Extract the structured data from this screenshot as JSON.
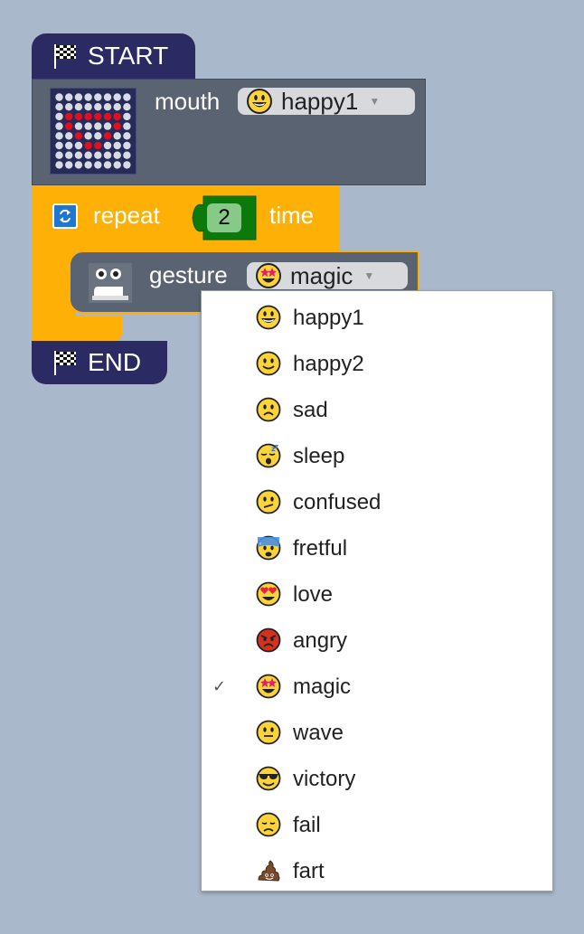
{
  "start_block": {
    "label": "START",
    "icon": "checkered-flag-icon"
  },
  "end_block": {
    "label": "END",
    "icon": "checkered-flag-icon"
  },
  "mouth_block": {
    "label": "mouth",
    "selected": {
      "label": "happy1",
      "icon": "grinning-face-icon"
    }
  },
  "repeat_block": {
    "label": "repeat",
    "count": "2",
    "suffix": "time",
    "icon": "loop-icon"
  },
  "gesture_block": {
    "label": "gesture",
    "selected": {
      "label": "magic",
      "icon": "star-struck-face-icon"
    }
  },
  "gesture_menu": {
    "checked_index": 8,
    "check_mark": "✓",
    "items": [
      {
        "label": "happy1",
        "icon": "grinning-face-icon"
      },
      {
        "label": "happy2",
        "icon": "slightly-smiling-face-icon"
      },
      {
        "label": "sad",
        "icon": "frowning-face-icon"
      },
      {
        "label": "sleep",
        "icon": "sleeping-face-icon"
      },
      {
        "label": "confused",
        "icon": "confused-face-icon"
      },
      {
        "label": "fretful",
        "icon": "anxious-sweat-face-icon"
      },
      {
        "label": "love",
        "icon": "heart-eyes-face-icon"
      },
      {
        "label": "angry",
        "icon": "angry-face-icon"
      },
      {
        "label": "magic",
        "icon": "star-struck-face-icon"
      },
      {
        "label": "wave",
        "icon": "neutral-face-icon"
      },
      {
        "label": "victory",
        "icon": "sunglasses-face-icon"
      },
      {
        "label": "fail",
        "icon": "disappointed-face-icon"
      },
      {
        "label": "fart",
        "icon": "poop-icon"
      }
    ]
  },
  "colors": {
    "background": "#a9b8ca",
    "hat_block": "#2b2a63",
    "action_block": "#5a6371",
    "control_block": "#feb006",
    "number_block": "#0b7a0b"
  }
}
